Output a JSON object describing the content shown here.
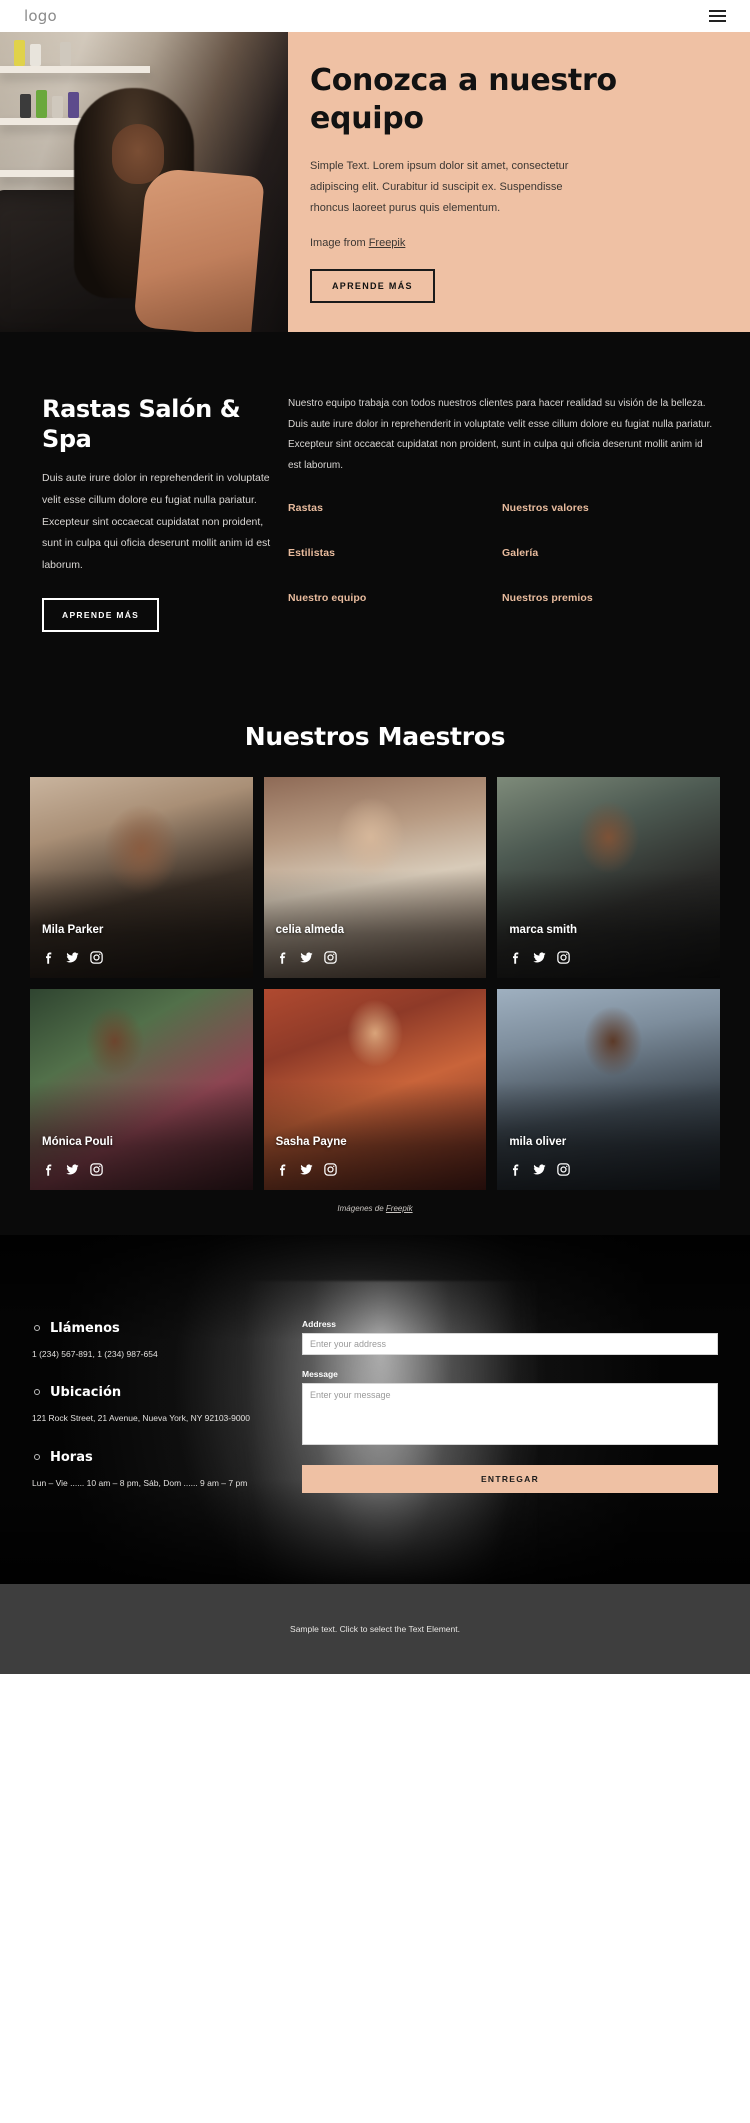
{
  "topbar": {
    "logo": "logo",
    "menu_icon": "hamburger-menu-icon"
  },
  "hero": {
    "title": "Conozca a nuestro equipo",
    "paragraph": "Simple Text. Lorem ipsum dolor sit amet, consectetur adipiscing elit. Curabitur id suscipit ex. Suspendisse rhoncus laoreet purus quis elementum.",
    "credit_prefix": "Image from ",
    "credit_link": "Freepik",
    "cta": "APRENDE MÁS",
    "panel_color": "#efc1a4"
  },
  "about": {
    "title": "Rastas Salón & Spa",
    "paragraph": "Duis aute irure dolor in reprehenderit in voluptate velit esse cillum dolore eu fugiat nulla pariatur. Excepteur sint occaecat cupidatat non proident, sunt in culpa qui oficia deserunt mollit anim id est laborum.",
    "cta": "APRENDE MÁS",
    "paragraph_right": "Nuestro equipo trabaja con todos nuestros clientes para hacer realidad su visión de la belleza. Duis aute irure dolor in reprehenderit in voluptate velit esse cillum dolore eu fugiat nulla pariatur. Excepteur sint occaecat cupidatat non proident, sunt in culpa qui oficia deserunt mollit anim id est laborum.",
    "link_color": "#e8bb9d",
    "links": [
      "Rastas",
      "Nuestros valores",
      "Estilistas",
      "Galería",
      "Nuestro equipo",
      "Nuestros premios"
    ]
  },
  "team": {
    "title": "Nuestros Maestros",
    "credit_prefix": "Imágenes de ",
    "credit_link": "Freepik",
    "social_icons": [
      "facebook-icon",
      "twitter-icon",
      "instagram-icon"
    ],
    "members": [
      {
        "name": "Mila Parker"
      },
      {
        "name": "celia almeda"
      },
      {
        "name": "marca smith"
      },
      {
        "name": "Mónica Pouli"
      },
      {
        "name": "Sasha Payne"
      },
      {
        "name": "mila oliver"
      }
    ]
  },
  "contact": {
    "blocks": [
      {
        "heading": "Llámenos",
        "text": "1 (234) 567-891, 1 (234) 987-654"
      },
      {
        "heading": "Ubicación",
        "text": "121 Rock Street, 21 Avenue, Nueva York, NY 92103-9000"
      },
      {
        "heading": "Horas",
        "text": "Lun – Vie ...... 10 am – 8 pm, Sáb, Dom ...... 9 am – 7 pm"
      }
    ],
    "form": {
      "address_label": "Address",
      "address_placeholder": "Enter your address",
      "address_value": "",
      "message_label": "Message",
      "message_placeholder": "Enter your message",
      "message_value": "",
      "submit": "ENTREGAR",
      "submit_color": "#efc1a4"
    }
  },
  "footer": {
    "text": "Sample text. Click to select the Text Element."
  }
}
